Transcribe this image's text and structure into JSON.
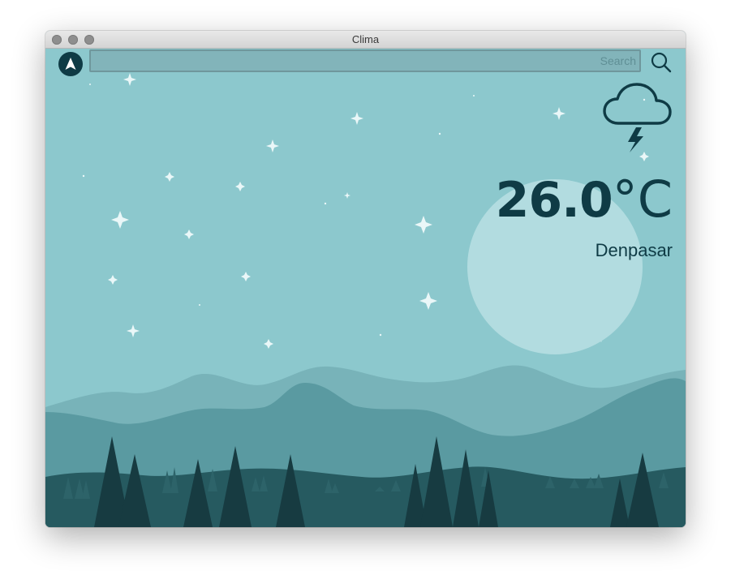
{
  "window": {
    "title": "Clima"
  },
  "search": {
    "placeholder": "Search",
    "value": ""
  },
  "icons": {
    "location": "navigation-arrow-icon",
    "search": "magnifier-icon",
    "weather": "cloud-lightning-icon"
  },
  "weather": {
    "temperature": "26.0",
    "unit": "°C",
    "city": "Denpasar"
  },
  "colors": {
    "sky": "#8cc8cd",
    "moon": "#b2dce0",
    "hills_far": "#78b3b9",
    "hills_mid": "#5a9aa1",
    "ground": "#265a60",
    "trees": "#173b41",
    "text_dark": "#0f3b45"
  }
}
